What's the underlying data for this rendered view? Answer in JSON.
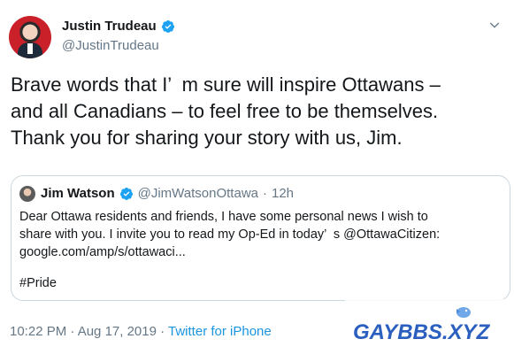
{
  "tweet": {
    "author": {
      "name": "Justin Trudeau",
      "handle": "@JustinTrudeau",
      "verified_icon": "verified-badge-icon"
    },
    "menu_icon": "chevron-down-icon",
    "text_lines": [
      "Brave words that I’  m sure will inspire Ottawans –",
      "and all Canadians – to feel free to be themselves.",
      "Thank you for sharing your story with us, Jim."
    ],
    "quoted": {
      "name": "Jim Watson",
      "handle": "@JimWatsonOttawa",
      "separator": "·",
      "time": "12h",
      "text_lines": [
        "Dear Ottawa residents and friends, I have some personal news I wish to",
        "share with you. I invite you to read my Op-Ed in today’  s @OttawaCitizen:",
        "google.com/amp/s/ottawaci..."
      ],
      "hashtag": "#Pride"
    },
    "footer": {
      "timestamp": "10:22 PM · Aug 17, 2019 · ",
      "source": "Twitter for iPhone"
    }
  },
  "watermark": {
    "text": "GAYBBS.XYZ"
  },
  "colors": {
    "text": "#14171a",
    "secondary": "#657786",
    "link": "#1b95e0",
    "verified": "#1da1f2",
    "border": "#ccd6dd",
    "watermark": "#2a5fbf"
  }
}
